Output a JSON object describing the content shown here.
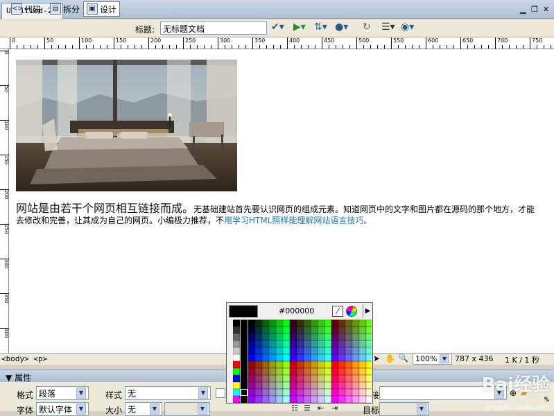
{
  "document_tab": {
    "title": "Untitled-2*"
  },
  "window_controls": {
    "close": "✕",
    "restore": "❐"
  },
  "toolbar": {
    "code_label": "代码",
    "split_label": "拆分",
    "design_label": "设计",
    "title_label": "标题:",
    "title_value": "无标题文档"
  },
  "ruler": {
    "h_ticks": [
      "0",
      "50",
      "100",
      "150",
      "200",
      "250",
      "300",
      "350",
      "400",
      "450",
      "500",
      "550",
      "600",
      "650",
      "700",
      "750"
    ],
    "v_ticks": [
      "0",
      "50",
      "100",
      "150",
      "200",
      "250",
      "300",
      "350",
      "400"
    ]
  },
  "content": {
    "heading": "网站是由若干个网页相互链接而成。",
    "body": "无基础建站首先要认识网页的组成元素。知道网页中的文字和图片都在源码的那个地方，才能去修改和完善，让其成为自己的网页。小编极力推荐，不",
    "link": "用学习HTML照样能理解网站语言技巧。"
  },
  "status": {
    "tags": "<body> <p>",
    "zoom": "100%",
    "size": "787 x 436",
    "filesize": "1 K / 1 秒"
  },
  "properties": {
    "header": "属性",
    "format_label": "格式",
    "format_value": "段落",
    "style_label": "样式",
    "style_value": "无",
    "font_label": "字体",
    "font_value": "默认字体",
    "size_label": "大小",
    "size_value": "无",
    "link_label": "接",
    "target_label": "目标"
  },
  "color_palette": {
    "hex": "#000000",
    "selected_color": "#000000"
  },
  "watermark": {
    "brand": "Bai经验",
    "url": "jingyan.baidu.com"
  }
}
